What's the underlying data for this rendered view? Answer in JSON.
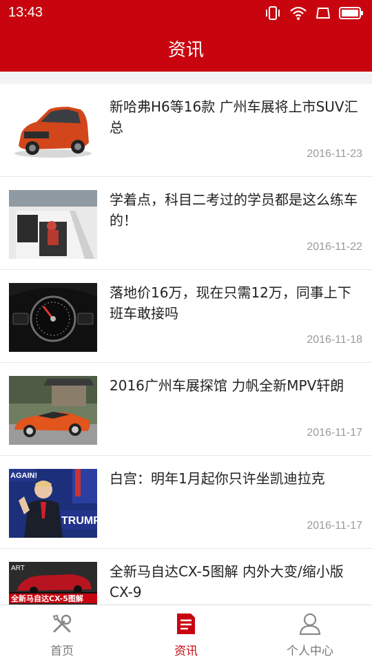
{
  "status_bar": {
    "time": "13:43"
  },
  "header": {
    "title": "资讯"
  },
  "news": [
    {
      "title": "新哈弗H6等16款 广州车展将上市SUV汇总",
      "date": "2016-11-23"
    },
    {
      "title": "学着点，科目二考过的学员都是这么练车的！",
      "date": "2016-11-22"
    },
    {
      "title": "落地价16万，现在只需12万，同事上下班车敢接吗",
      "date": "2016-11-18"
    },
    {
      "title": "2016广州车展探馆 力帆全新MPV轩朗",
      "date": "2016-11-17"
    },
    {
      "title": "白宫：明年1月起你只许坐凯迪拉克",
      "date": "2016-11-17"
    },
    {
      "title": "全新马自达CX-5图解 内外大变/缩小版CX-9",
      "date": ""
    }
  ],
  "thumb_text": {
    "trump_sign": "TRUMP",
    "again": "AGAIN!",
    "art": "ART",
    "cx5_caption": "全新马自达CX-5图解"
  },
  "tabs": [
    {
      "label": "首页",
      "icon": "tools-icon",
      "active": false
    },
    {
      "label": "资讯",
      "icon": "document-icon",
      "active": true
    },
    {
      "label": "个人中心",
      "icon": "user-icon",
      "active": false
    }
  ],
  "colors": {
    "brand_red": "#c8050f",
    "date_gray": "#9a9a9a",
    "tab_gray": "#777777"
  }
}
